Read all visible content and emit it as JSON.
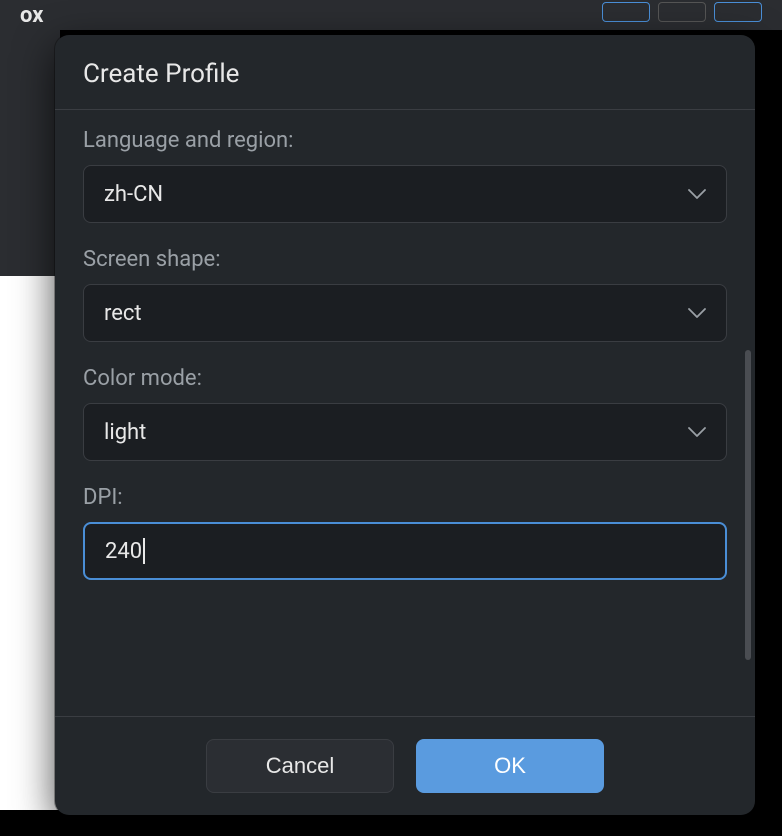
{
  "app": {
    "title_fragment": "ox"
  },
  "dialog": {
    "title": "Create Profile",
    "fields": {
      "language_region": {
        "label": "Language and region:",
        "value": "zh-CN"
      },
      "screen_shape": {
        "label": "Screen shape:",
        "value": "rect"
      },
      "color_mode": {
        "label": "Color mode:",
        "value": "light"
      },
      "dpi": {
        "label": "DPI:",
        "value": "240"
      }
    },
    "buttons": {
      "cancel": "Cancel",
      "ok": "OK"
    }
  },
  "colors": {
    "accent": "#4a8ed6",
    "primary_button": "#5a9bdf",
    "dialog_bg": "#23272b",
    "input_bg": "#1b1e22",
    "text": "#e8e8e8",
    "label": "#9aa0a6"
  }
}
